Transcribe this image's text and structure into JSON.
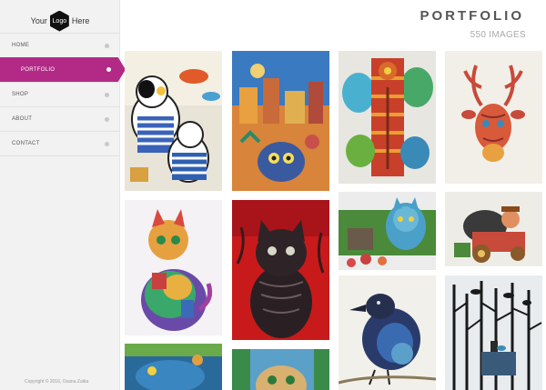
{
  "logo": {
    "left_word": "Your",
    "center_word": "Logo",
    "right_word": "Here"
  },
  "nav": {
    "items": [
      {
        "label": "HOME"
      },
      {
        "label": "PORTFOLIO"
      },
      {
        "label": "SHOP"
      },
      {
        "label": "ABOUT"
      },
      {
        "label": "CONTACT"
      }
    ]
  },
  "header": {
    "title": "PORTFOLIO",
    "subtitle": "550 IMAGES"
  },
  "footer": {
    "copyright": "Copyright © 2016, Oxana Zaika"
  },
  "colors": {
    "accent": "#b22a86",
    "sidebar_bg": "#f2f2f2"
  },
  "gallery": {
    "items": [
      {
        "subject": "cats-with-fish-painting"
      },
      {
        "subject": "owl-city-painting"
      },
      {
        "subject": "tree-mosaic-painting"
      },
      {
        "subject": "deer-painting"
      },
      {
        "subject": "rainbow-cat-painting"
      },
      {
        "subject": "black-cat-red-painting"
      },
      {
        "subject": "cat-landscape-painting"
      },
      {
        "subject": "bear-in-car-painting"
      },
      {
        "subject": "blue-animal-painting"
      },
      {
        "subject": "cat-face-painting"
      },
      {
        "subject": "raven-painting"
      },
      {
        "subject": "birds-in-trees-painting"
      }
    ]
  }
}
